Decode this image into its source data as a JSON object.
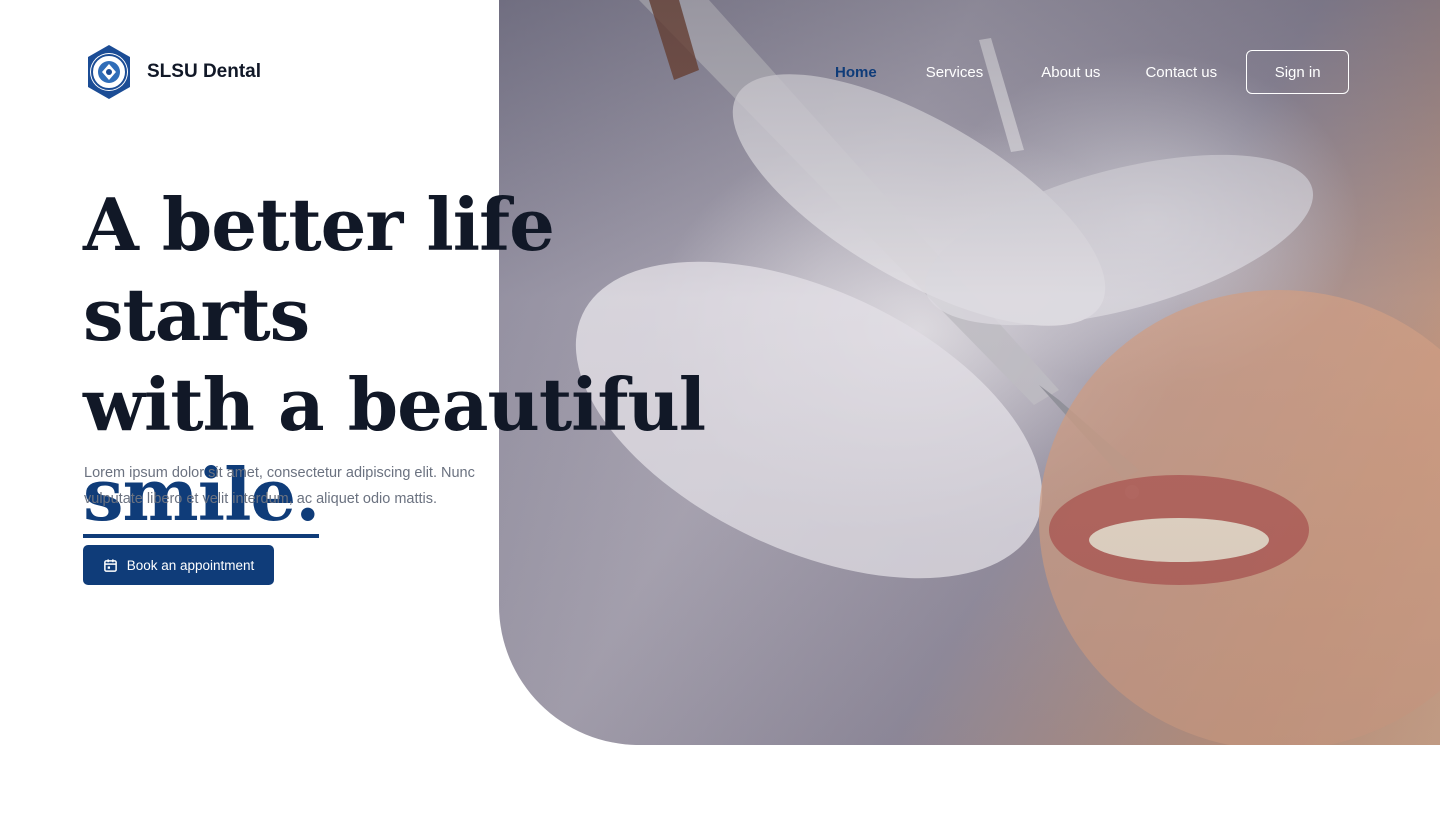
{
  "brand": {
    "name": "SLSU Dental",
    "logo_icon": "university-seal-icon"
  },
  "nav": {
    "items": [
      {
        "label": "Home",
        "active": true
      },
      {
        "label": "Services"
      },
      {
        "label": "About us"
      },
      {
        "label": "Contact us"
      }
    ],
    "signin_label": "Sign in"
  },
  "hero": {
    "headline_line1": "A better life starts",
    "headline_line2": "with a beautiful",
    "headline_accent": "smile.",
    "lead_line1": "Lorem ipsum dolor sit amet, consectetur adipiscing elit. Nunc",
    "lead_line2": "vulputate libero et velit interdum, ac aliquet odio mattis.",
    "cta_label": "Book an appointment",
    "cta_icon": "calendar-icon",
    "image_subject": "dentist-treatment-photo"
  },
  "colors": {
    "accent": "#0f3c79",
    "heading": "#111827",
    "body_text": "#6b7280",
    "nav_on_image": "#ffffff"
  }
}
